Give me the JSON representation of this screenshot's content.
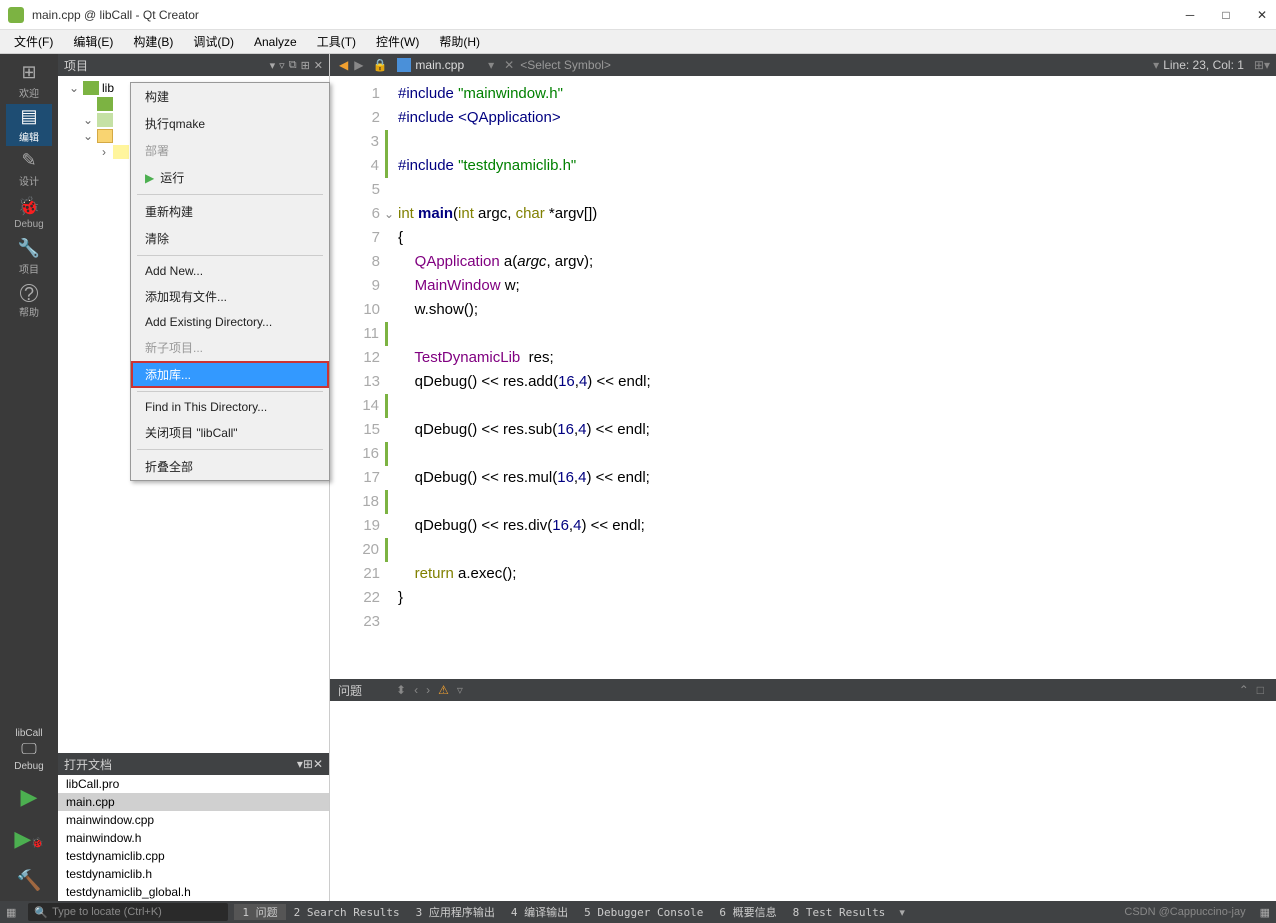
{
  "window": {
    "title": "main.cpp @ libCall - Qt Creator"
  },
  "menu": [
    "文件(F)",
    "编辑(E)",
    "构建(B)",
    "调试(D)",
    "Analyze",
    "工具(T)",
    "控件(W)",
    "帮助(H)"
  ],
  "sidebar": {
    "items": [
      {
        "label": "欢迎",
        "glyph": "⊞"
      },
      {
        "label": "编辑",
        "glyph": "▤"
      },
      {
        "label": "设计",
        "glyph": "✎"
      },
      {
        "label": "Debug",
        "glyph": "🐞"
      },
      {
        "label": "项目",
        "glyph": "🔧"
      },
      {
        "label": "帮助",
        "glyph": "?"
      }
    ],
    "kit": "libCall",
    "debug": "Debug"
  },
  "project_panel": {
    "title": "项目",
    "tree": [
      {
        "label": "lib"
      },
      {
        "label": ""
      },
      {
        "label": ""
      },
      {
        "label": ""
      }
    ]
  },
  "context_menu": {
    "build": "构建",
    "qmake": "执行qmake",
    "deploy": "部署",
    "run": "运行",
    "rebuild": "重新构建",
    "clean": "清除",
    "add_new": "Add New...",
    "add_existing": "添加现有文件...",
    "add_dir": "Add Existing Directory...",
    "new_sub": "新子项目...",
    "add_lib": "添加库...",
    "find_dir": "Find in This Directory...",
    "close_proj": "关闭项目 \"libCall\"",
    "collapse": "折叠全部"
  },
  "open_docs": {
    "title": "打开文档",
    "items": [
      "libCall.pro",
      "main.cpp",
      "mainwindow.cpp",
      "mainwindow.h",
      "testdynamiclib.cpp",
      "testdynamiclib.h",
      "testdynamiclib_global.h"
    ]
  },
  "editor": {
    "filename": "main.cpp",
    "symbol": "<Select Symbol>",
    "linecol": "Line: 23, Col: 1",
    "lines": 23
  },
  "problems": {
    "title": "问题"
  },
  "statusbar": {
    "search_placeholder": "Type to locate (Ctrl+K)",
    "tabs": [
      "1 问题",
      "2 Search Results",
      "3 应用程序输出",
      "4 编译输出",
      "5 Debugger Console",
      "6 概要信息",
      "8 Test Results"
    ],
    "watermark": "CSDN @Cappuccino-jay"
  }
}
